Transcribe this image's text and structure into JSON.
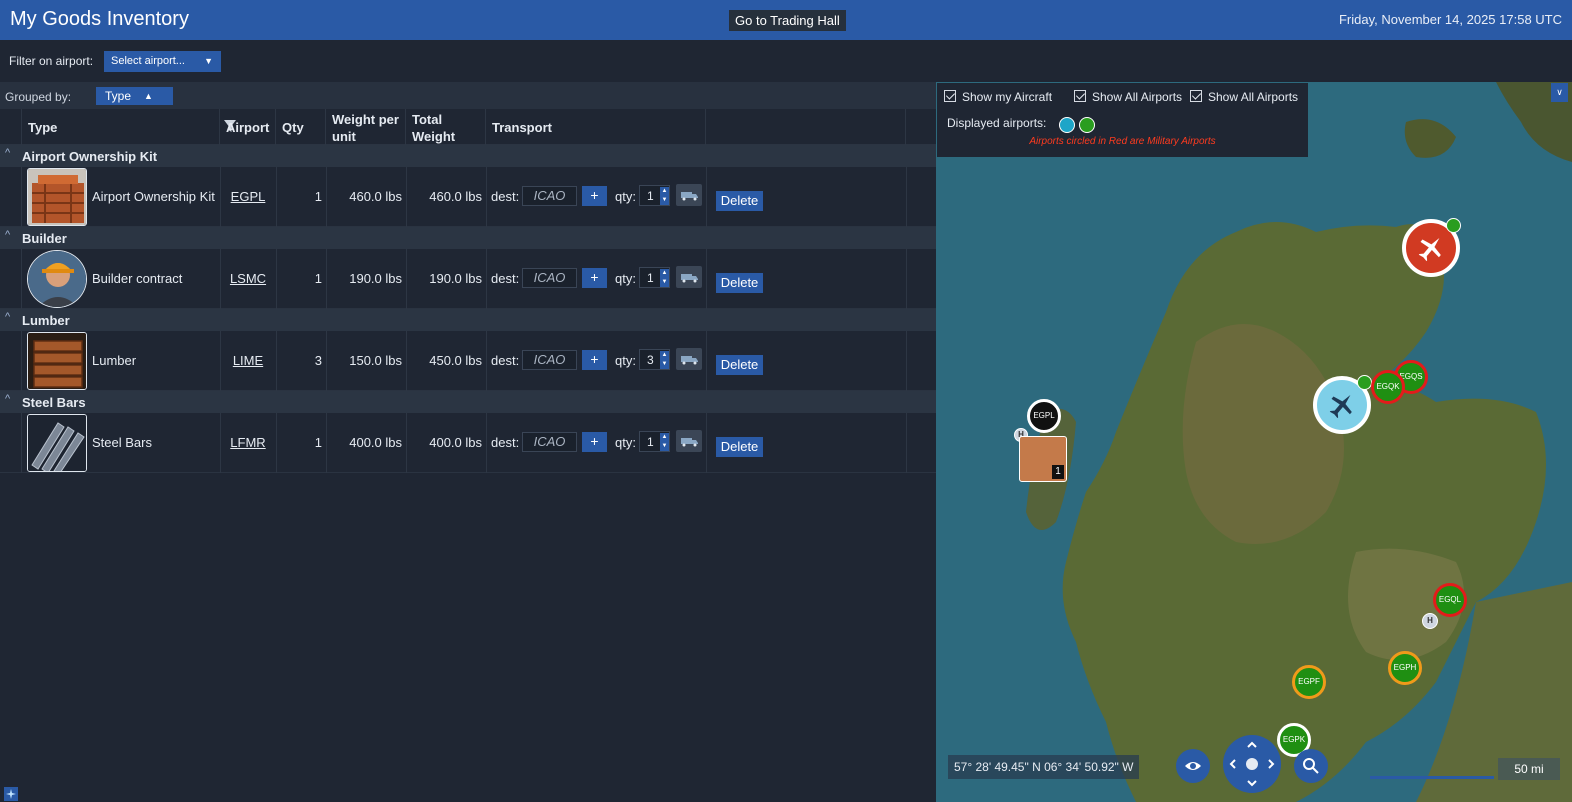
{
  "header": {
    "title": "My Goods Inventory",
    "trading_hall_button": "Go to Trading Hall",
    "datetime": "Friday, November 14, 2025 17:58 UTC"
  },
  "filter": {
    "label": "Filter on airport:",
    "select_value": "Select airport...",
    "caret": "▼"
  },
  "grouping": {
    "label": "Grouped by:",
    "value": "Type",
    "arrow": "▲"
  },
  "columns": {
    "type": "Type",
    "airport": "Airport",
    "qty": "Qty",
    "weight_per_unit_1": "Weight per",
    "weight_per_unit_2": "unit",
    "total_weight_1": "Total",
    "total_weight_2": "Weight",
    "transport": "Transport"
  },
  "ui": {
    "chevron": "^",
    "dest_label": "dest:",
    "icao_placeholder": "ICAO",
    "plus": "+",
    "qty_label": "qty:",
    "up": "▲",
    "down": "▼",
    "delete": "Delete"
  },
  "groups": [
    {
      "name": "Airport Ownership Kit",
      "item": {
        "name": "Airport Ownership Kit",
        "airport": "EGPL",
        "qty": "1",
        "weight_per_unit": "460.0 lbs",
        "total_weight": "460.0 lbs",
        "transport_qty": "1",
        "icon": "crate-icon"
      }
    },
    {
      "name": "Builder",
      "item": {
        "name": "Builder contract",
        "airport": "LSMC",
        "qty": "1",
        "weight_per_unit": "190.0 lbs",
        "total_weight": "190.0 lbs",
        "transport_qty": "1",
        "icon": "builder-avatar"
      }
    },
    {
      "name": "Lumber",
      "item": {
        "name": "Lumber",
        "airport": "LIME",
        "qty": "3",
        "weight_per_unit": "150.0 lbs",
        "total_weight": "450.0 lbs",
        "transport_qty": "3",
        "icon": "lumber-icon"
      }
    },
    {
      "name": "Steel Bars",
      "item": {
        "name": "Steel Bars",
        "airport": "LFMR",
        "qty": "1",
        "weight_per_unit": "400.0 lbs",
        "total_weight": "400.0 lbs",
        "transport_qty": "1",
        "icon": "steel-icon"
      }
    }
  ],
  "map": {
    "show_my_aircraft": "Show my Aircraft",
    "show_all_airports_1": "Show All Airports",
    "show_all_airports_2": "Show All Airports",
    "displayed_airports_label": "Displayed airports:",
    "military_note": "Airports circled in Red are Military Airports",
    "collapse": "∨",
    "legend_colors": [
      "#1ea5c8",
      "#2a9d1f"
    ],
    "coordinates": "57° 28' 49.45\" N 06° 34' 50.92\" W",
    "scale": "50 mi",
    "stack_count": "1",
    "heliport": "H",
    "markers": [
      {
        "code": "EGPL",
        "kind": "black"
      },
      {
        "code": "EGQK",
        "kind": "military"
      },
      {
        "code": "EGQS",
        "kind": "military"
      },
      {
        "code": "EGQL",
        "kind": "military"
      },
      {
        "code": "EGPH",
        "kind": "orange"
      },
      {
        "code": "EGPF",
        "kind": "orange"
      },
      {
        "code": "EGPK",
        "kind": "white"
      }
    ],
    "colors": {
      "military_ring": "#e31b1b",
      "civil_ring": "#f09a1a",
      "airport_fill": "#1f8f12"
    }
  }
}
